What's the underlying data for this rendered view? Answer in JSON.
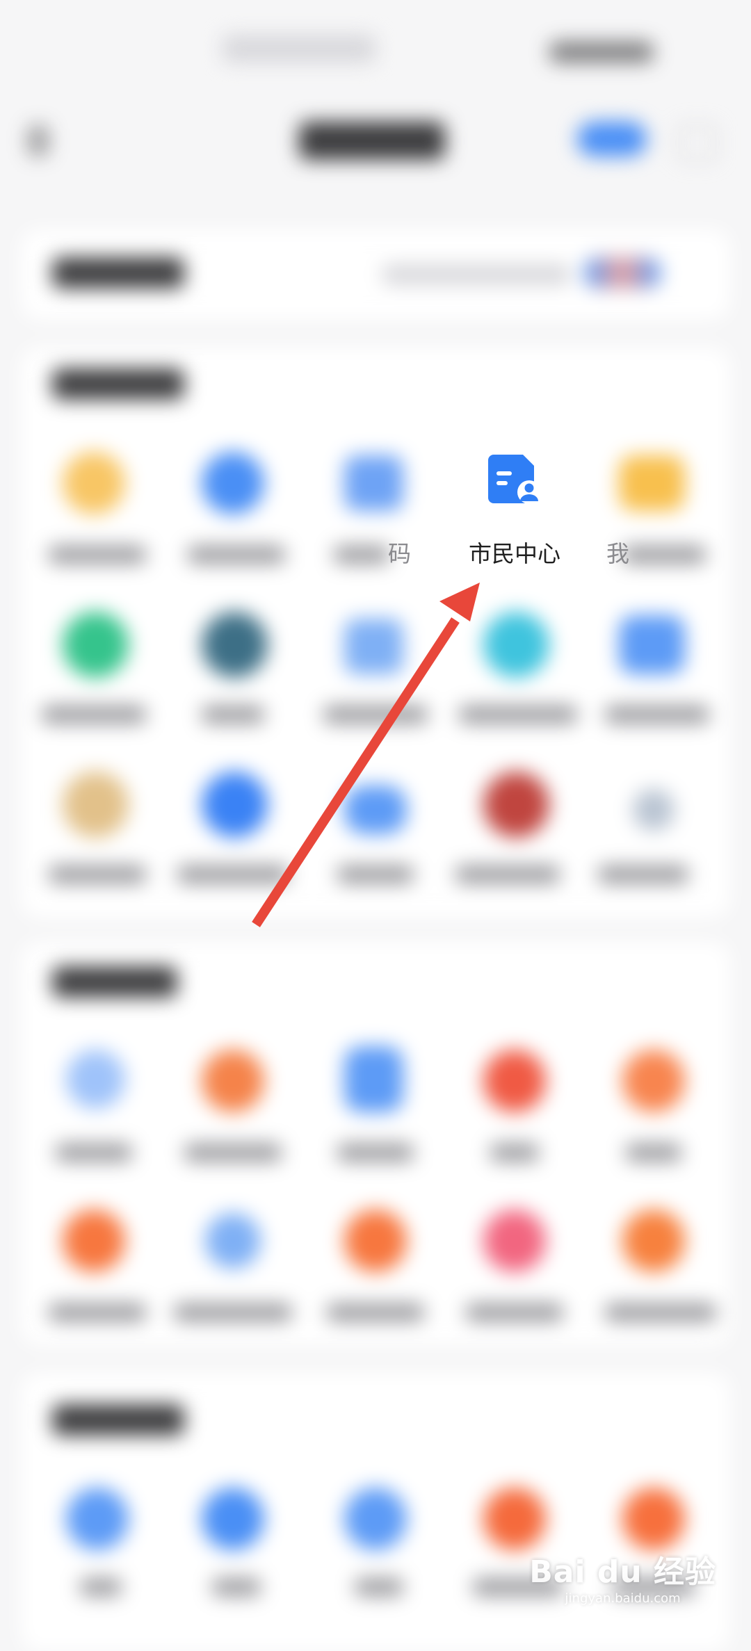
{
  "focused_app": {
    "label": "市民中心",
    "icon": "document-person-icon",
    "icon_color": "#2f7ef5"
  },
  "partial_labels": {
    "left_neighbor_tail": "码",
    "right_neighbor_head": "我"
  },
  "colors": {
    "background": "#f6f6f7",
    "card": "#ffffff",
    "accent_blue": "#2f7ef5",
    "arrow_red": "#e8473a"
  },
  "watermark": {
    "logo": "Bai du 经验",
    "url": "jingyan.baidu.com"
  }
}
